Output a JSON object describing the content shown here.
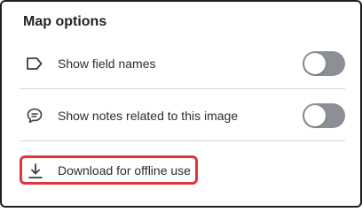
{
  "panel": {
    "title": "Map options"
  },
  "options": [
    {
      "label": "Show field names",
      "icon": "label-icon",
      "toggle_on": false
    },
    {
      "label": "Show notes related to this image",
      "icon": "note-icon",
      "toggle_on": false
    }
  ],
  "download": {
    "label": "Download for offline use",
    "icon": "download-icon",
    "highlight_color": "#e3343a"
  },
  "colors": {
    "toggle_off": "#8c8f95",
    "divider": "#d4d6d9"
  }
}
